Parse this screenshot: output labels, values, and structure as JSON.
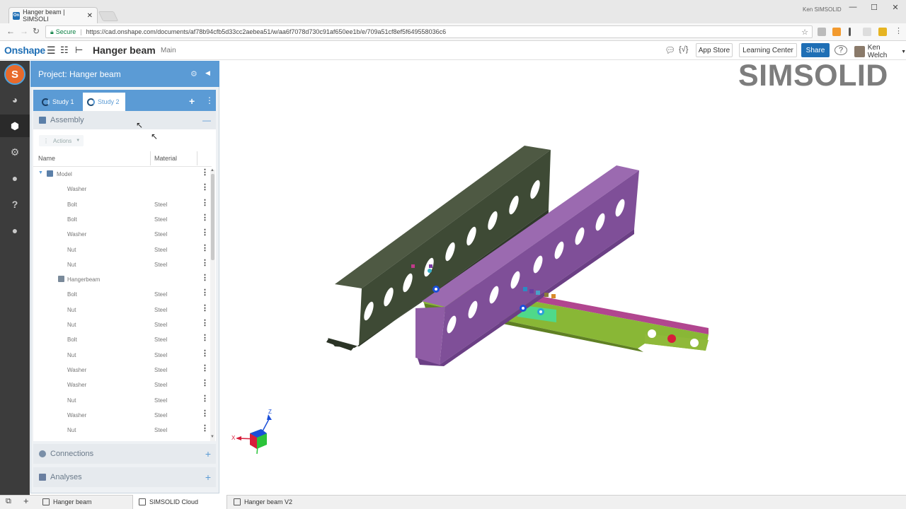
{
  "browser": {
    "tab_title": "Hanger beam | SIMSOLI",
    "tab_favicon": "On",
    "window_user": "Ken SIMSOLID",
    "secure_label": "Secure",
    "url": "https://cad.onshape.com/documents/af78b94cfb5d33cc2aebea51/w/aa6f7078d730c91af650ee1b/e/709a51cf8ef5f649558036c6"
  },
  "onshape": {
    "logo": "Onshape",
    "doc_title": "Hanger beam",
    "branch": "Main",
    "app_store": "App Store",
    "learning_center": "Learning Center",
    "share": "Share",
    "user": "Ken Welch",
    "help": "?",
    "variable_icon": "{√}"
  },
  "panel": {
    "title": "Project: Hanger beam",
    "studies": [
      "Study 1",
      "Study 2"
    ],
    "active_study": "Study 2",
    "assembly_label": "Assembly",
    "actions_label": "Actions",
    "col_name": "Name",
    "col_material": "Material",
    "rows": [
      {
        "name": "Model",
        "material": "",
        "level": 0,
        "type": "assembly"
      },
      {
        "name": "Washer",
        "material": "",
        "level": 1,
        "type": "part"
      },
      {
        "name": "Bolt",
        "material": "Steel",
        "level": 1,
        "type": "part"
      },
      {
        "name": "Bolt",
        "material": "Steel",
        "level": 1,
        "type": "part"
      },
      {
        "name": "Washer",
        "material": "Steel",
        "level": 1,
        "type": "part"
      },
      {
        "name": "Nut",
        "material": "Steel",
        "level": 1,
        "type": "part"
      },
      {
        "name": "Nut",
        "material": "Steel",
        "level": 1,
        "type": "part"
      },
      {
        "name": "Hangerbeam",
        "material": "",
        "level": 1,
        "type": "solid"
      },
      {
        "name": "Bolt",
        "material": "Steel",
        "level": 1,
        "type": "part"
      },
      {
        "name": "Nut",
        "material": "Steel",
        "level": 1,
        "type": "part"
      },
      {
        "name": "Nut",
        "material": "Steel",
        "level": 1,
        "type": "part"
      },
      {
        "name": "Bolt",
        "material": "Steel",
        "level": 1,
        "type": "part"
      },
      {
        "name": "Nut",
        "material": "Steel",
        "level": 1,
        "type": "part"
      },
      {
        "name": "Washer",
        "material": "Steel",
        "level": 1,
        "type": "part"
      },
      {
        "name": "Washer",
        "material": "Steel",
        "level": 1,
        "type": "part"
      },
      {
        "name": "Nut",
        "material": "Steel",
        "level": 1,
        "type": "part"
      },
      {
        "name": "Washer",
        "material": "Steel",
        "level": 1,
        "type": "part"
      },
      {
        "name": "Nut",
        "material": "Steel",
        "level": 1,
        "type": "part"
      }
    ],
    "connections_label": "Connections",
    "analyses_label": "Analyses"
  },
  "viewport": {
    "brand": "SIMSOLID",
    "axis_x": "X",
    "axis_z": "Z"
  },
  "bottom_tabs": {
    "tabs": [
      "Hanger beam",
      "SIMSOLID Cloud",
      "Hanger beam V2"
    ],
    "active": "SIMSOLID Cloud"
  },
  "colors": {
    "accent": "#5b9bd5",
    "onshape_blue": "#1f6fb5",
    "rail": "#3c3c3c",
    "beam_dark": "#3f4a3a",
    "beam_purple": "#8a5a9a",
    "plate_green": "#8ab83a"
  }
}
